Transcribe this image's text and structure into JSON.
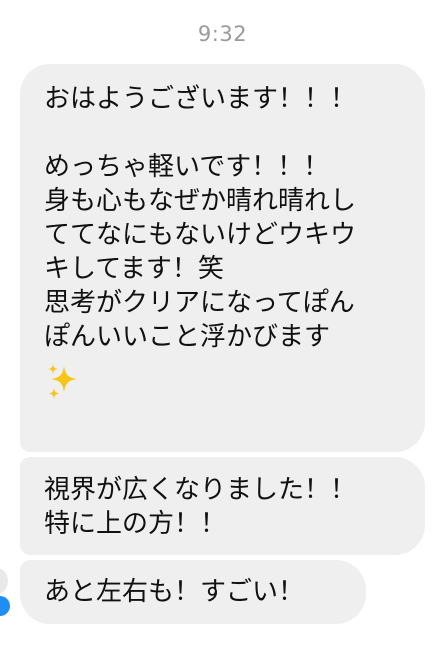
{
  "header": {
    "timestamp": "9:32"
  },
  "messages": [
    {
      "lines": [
        "おはようございます！！！",
        "",
        "めっちゃ軽いです！！！",
        "身も心もなぜか晴れ晴れし",
        "ててなにもないけどウキウ",
        "キしてます！笑",
        "思考がクリアになってぽん",
        "ぽんいいこと浮かびます"
      ],
      "emoji": "sparkles-icon"
    },
    {
      "lines": [
        "視界が広くなりました！！",
        "特に上の方！！"
      ]
    },
    {
      "lines": [
        "あと左右も！すごい！"
      ]
    }
  ],
  "colors": {
    "bubble": "#efeff0",
    "timestamp": "#9a9a9a",
    "sparkle": "#f5c518",
    "avatar_badge": "#1e8ef5"
  }
}
